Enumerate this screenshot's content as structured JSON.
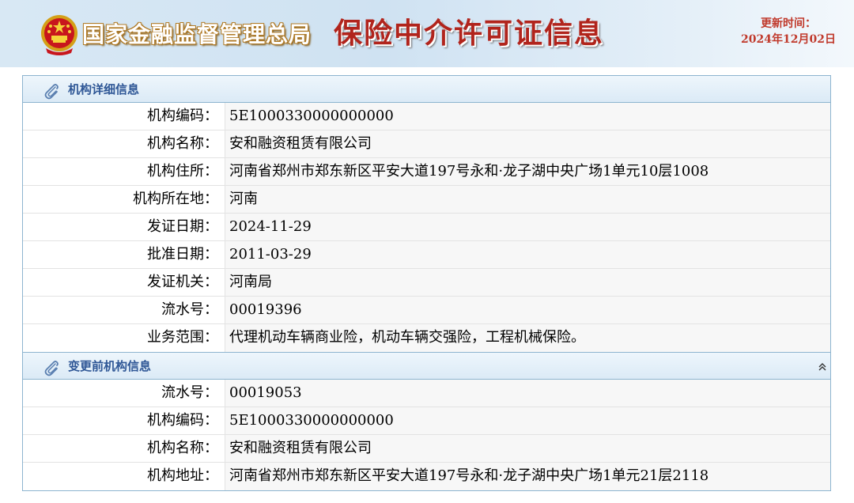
{
  "header": {
    "agency_name": "国家金融监督管理总局",
    "site_title": "保险中介许可证信息",
    "update_label": "更新时间：",
    "update_date": "2024年12月02日"
  },
  "sections": [
    {
      "title": "机构详细信息",
      "rows": [
        {
          "label": "机构编码：",
          "value": "5E1000330000000000"
        },
        {
          "label": "机构名称：",
          "value": "安和融资租赁有限公司"
        },
        {
          "label": "机构住所：",
          "value": "河南省郑州市郑东新区平安大道197号永和·龙子湖中央广场1单元10层1008"
        },
        {
          "label": "机构所在地：",
          "value": "河南"
        },
        {
          "label": "发证日期：",
          "value": "2024-11-29"
        },
        {
          "label": "批准日期：",
          "value": "2011-03-29"
        },
        {
          "label": "发证机关：",
          "value": "河南局"
        },
        {
          "label": "流水号：",
          "value": "00019396"
        },
        {
          "label": "业务范围：",
          "value": "代理机动车辆商业险，机动车辆交强险，工程机械保险。"
        }
      ]
    },
    {
      "title": "变更前机构信息",
      "rows": [
        {
          "label": "流水号：",
          "value": "00019053"
        },
        {
          "label": "机构编码：",
          "value": "5E1000330000000000"
        },
        {
          "label": "机构名称：",
          "value": "安和融资租赁有限公司"
        },
        {
          "label": "机构地址：",
          "value": "河南省郑州市郑东新区平安大道197号永和·龙子湖中央广场1单元21层2118"
        }
      ]
    }
  ],
  "icons": {
    "emblem": "national-emblem-icon",
    "section_icon": "paperclip-icon",
    "collapse": "double-chevron-up-icon"
  },
  "colors": {
    "title_red": "#b1241c",
    "section_title_blue": "#2f5796",
    "border_blue": "#8db4cf",
    "update_red": "#c0392b"
  }
}
